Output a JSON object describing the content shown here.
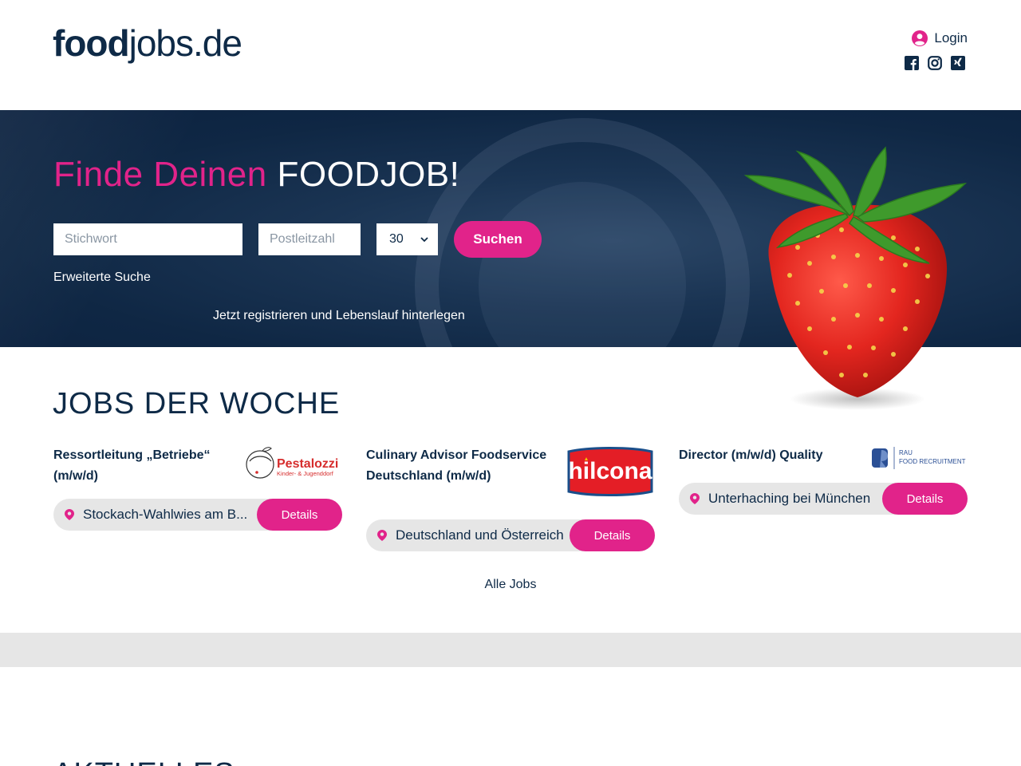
{
  "header": {
    "logo_bold": "food",
    "logo_light": "jobs.de",
    "login_label": "Login",
    "social_icons": [
      "facebook-icon",
      "instagram-icon",
      "xing-icon"
    ]
  },
  "hero": {
    "title_pink": "Finde Deinen",
    "title_white": "FOODJOB!",
    "keyword_placeholder": "Stichwort",
    "zip_placeholder": "Postleitzahl",
    "radius_value": "30",
    "search_button": "Suchen",
    "advanced_search": "Erweiterte Suche",
    "register_link": "Jetzt registrieren und Lebenslauf hinterlegen"
  },
  "jobs": {
    "section_title": "JOBS DER WOCHE",
    "items": [
      {
        "title": "Ressortleitung „Betriebe“ (m/w/d)",
        "company_logo": "Pestalozzi",
        "company_logo_sub": "Kinder- & Jugenddorf",
        "location": "Stockach-Wahlwies am B...",
        "details": "Details"
      },
      {
        "title": "Culinary Advisor Foodservice Deutschland (m/w/d)",
        "company_logo": "hilcona",
        "location": "Deutschland und Österreich",
        "details": "Details"
      },
      {
        "title": "Director (m/w/d) Quality",
        "company_logo": "RAU",
        "company_logo_sub": "FOOD RECRUITMENT",
        "location": "Unterhaching bei München",
        "details": "Details"
      }
    ],
    "all_jobs": "Alle Jobs"
  },
  "news": {
    "section_title": "AKTUELLES"
  },
  "colors": {
    "brand_pink": "#e1238a",
    "navy": "#0e2a47",
    "grey": "#e6e6e6"
  }
}
